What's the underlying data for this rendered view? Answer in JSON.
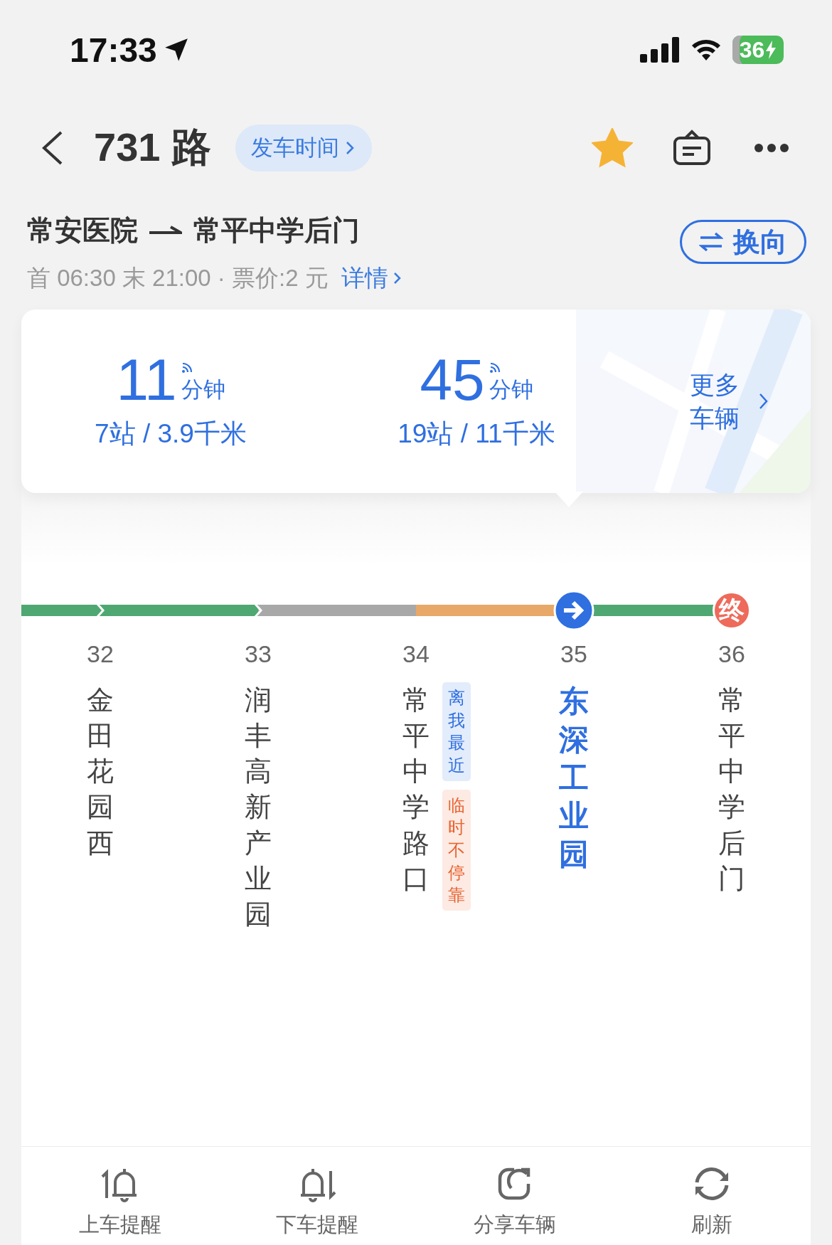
{
  "status_bar": {
    "time": "17:33",
    "battery": "36"
  },
  "header": {
    "title": "731 路",
    "departure_button": "发车时间",
    "favorite": true
  },
  "route": {
    "from": "常安医院",
    "to": "常平中学后门",
    "schedule": "首 06:30 末 21:00 · 票价:2 元",
    "details_link": "详情",
    "reverse_button": "换向"
  },
  "arrivals": [
    {
      "minutes": "11",
      "unit": "分钟",
      "info": "7站 / 3.9千米"
    },
    {
      "minutes": "45",
      "unit": "分钟",
      "info": "19站 / 11千米"
    }
  ],
  "more_vehicles": "更多车辆",
  "segments": [
    {
      "color": "#4fa872"
    },
    {
      "color": "#4fa872"
    },
    {
      "color": "#a8a8a8"
    },
    {
      "color": "#e8a868"
    },
    {
      "color": "#4fa872"
    }
  ],
  "stops": [
    {
      "number": "32",
      "name": "金田花园西",
      "selected": false
    },
    {
      "number": "33",
      "name": "润丰高新产业园",
      "selected": false
    },
    {
      "number": "34",
      "name": "常平中学路口",
      "selected": false,
      "tags": [
        {
          "text": "离我最近",
          "color": "#2f6fe0"
        },
        {
          "text": "临时不停靠",
          "color": "#e8622f"
        }
      ]
    },
    {
      "number": "35",
      "name": "东深工业园",
      "selected": true,
      "marker": {
        "kind": "current"
      }
    },
    {
      "number": "36",
      "name": "常平中学后门",
      "selected": false,
      "marker": {
        "kind": "terminal",
        "text": "终"
      }
    }
  ],
  "toolbar": [
    {
      "kind": "board",
      "label": "上车提醒"
    },
    {
      "kind": "alight",
      "label": "下车提醒"
    },
    {
      "kind": "share",
      "label": "分享车辆"
    },
    {
      "kind": "refresh",
      "label": "刷新"
    }
  ]
}
